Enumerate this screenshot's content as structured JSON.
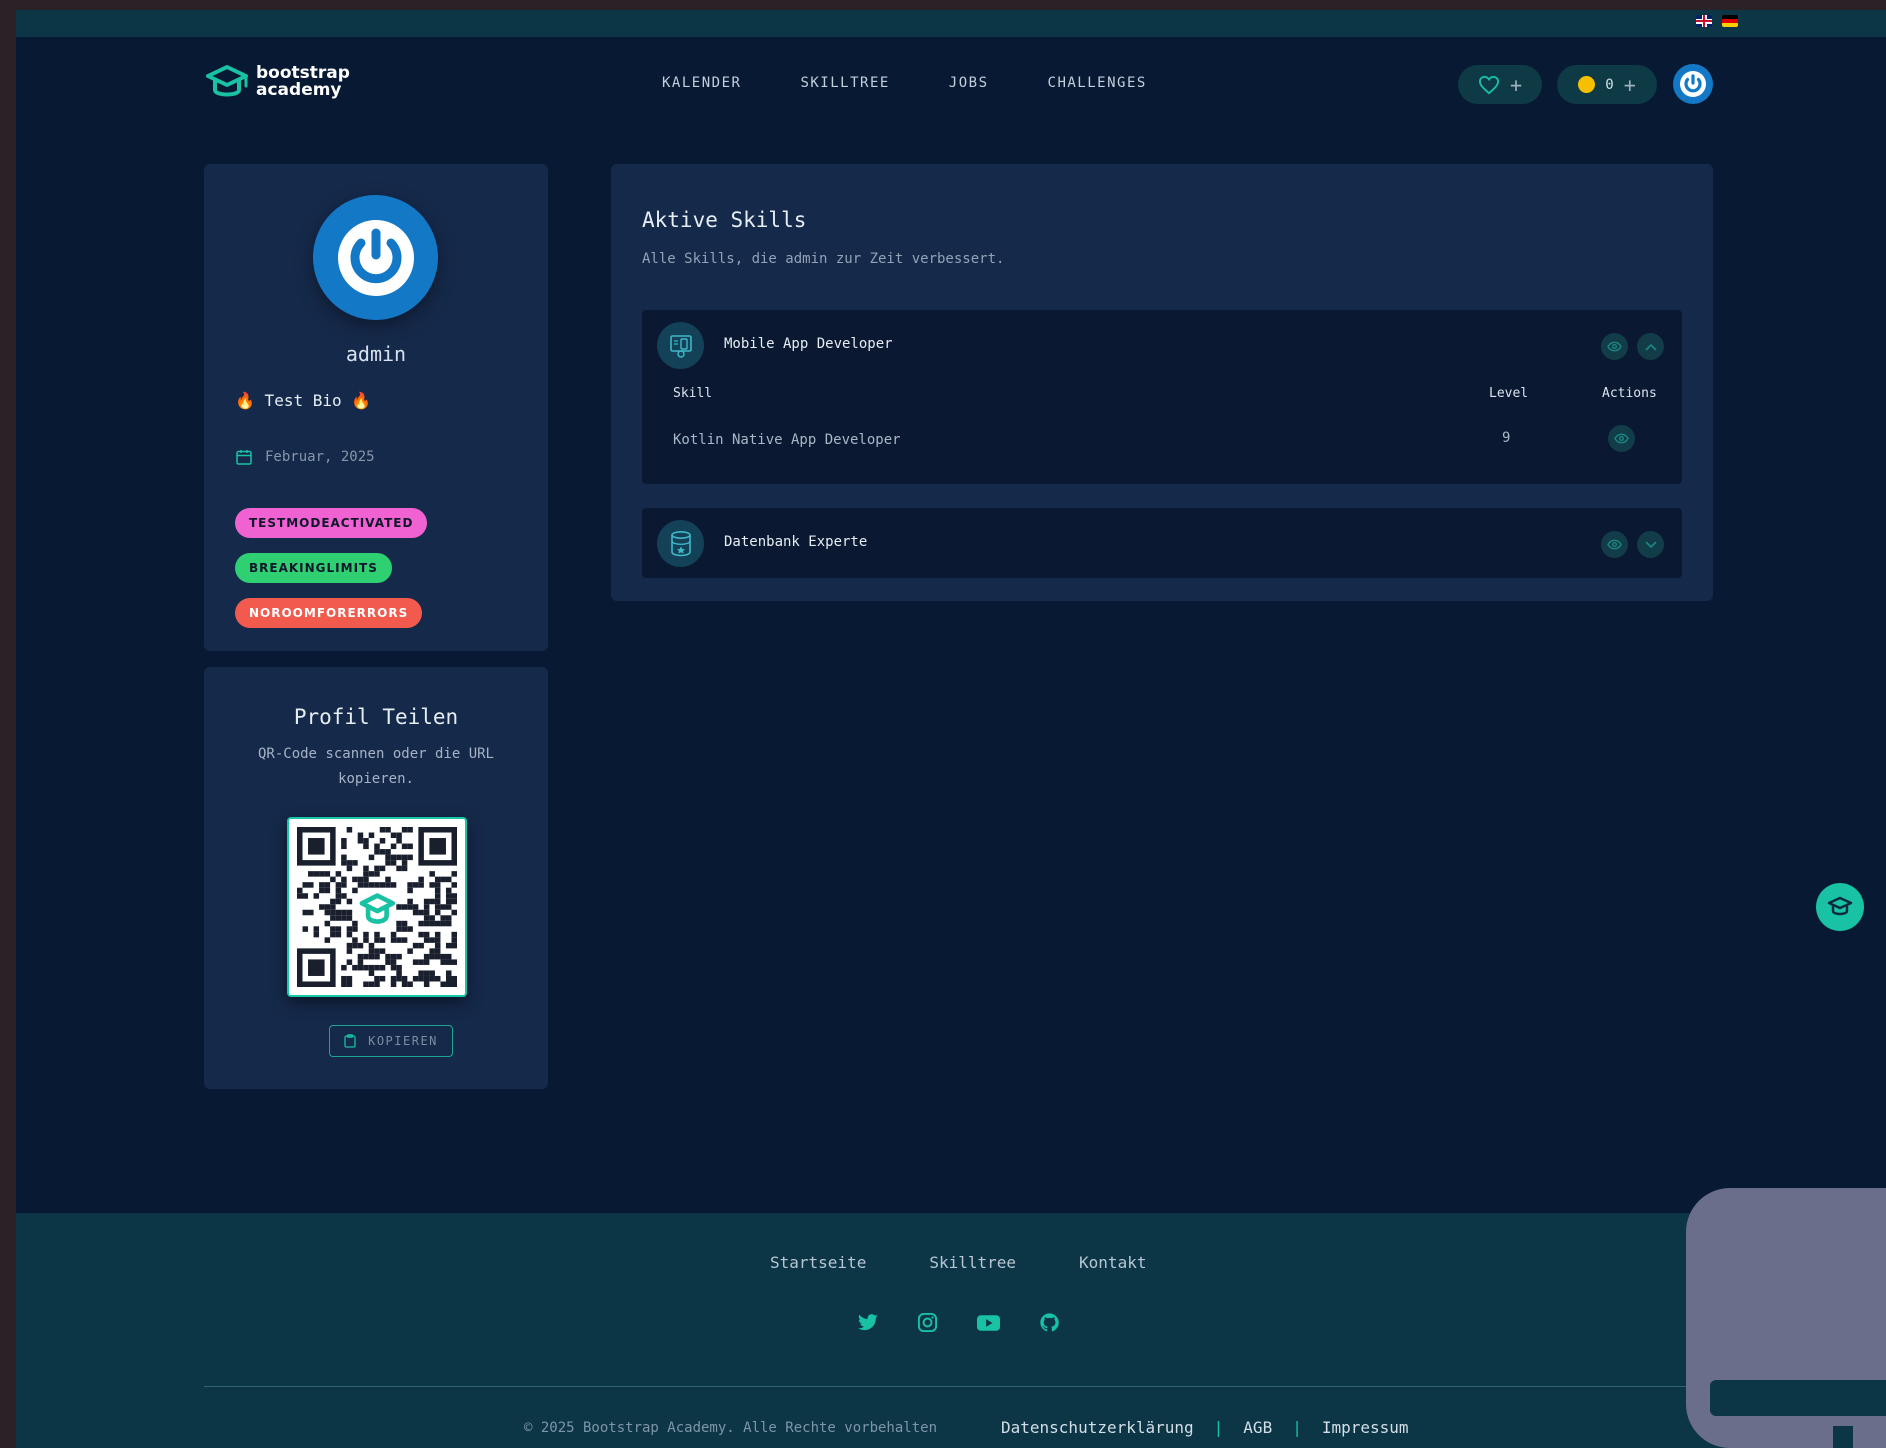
{
  "header": {
    "logo_line1": "bootstrap",
    "logo_line2": "academy",
    "nav": [
      "KALENDER",
      "SKILLTREE",
      "JOBS",
      "CHALLENGES"
    ],
    "hearts_add": "+",
    "coins_count": "0",
    "coins_add": "+"
  },
  "profile": {
    "username": "admin",
    "bio": "🔥 Test Bio 🔥",
    "joined": "Februar, 2025",
    "badges": [
      "TESTMODEACTIVATED",
      "BREAKINGLIMITS",
      "NOROOMFORERRORS"
    ]
  },
  "share": {
    "title": "Profil Teilen",
    "subtitle": "QR-Code scannen oder die URL kopieren.",
    "copy_label": "KOPIEREN"
  },
  "skills": {
    "title": "Aktive Skills",
    "subtitle": "Alle Skills, die admin zur Zeit verbessert.",
    "groups": [
      {
        "name": "Mobile App Developer",
        "expanded": true,
        "columns": [
          "Skill",
          "Level",
          "Actions"
        ],
        "rows": [
          {
            "skill": "Kotlin Native App Developer",
            "level": "9"
          }
        ]
      },
      {
        "name": "Datenbank Experte",
        "expanded": false
      }
    ]
  },
  "footer": {
    "nav": [
      "Startseite",
      "Skilltree",
      "Kontakt"
    ],
    "socials": [
      "twitter-icon",
      "instagram-icon",
      "youtube-icon",
      "github-icon"
    ],
    "copyright": "© 2025 Bootstrap Academy. Alle Rechte vorbehalten",
    "legal": [
      "Datenschutzerklärung",
      "AGB",
      "Impressum"
    ]
  },
  "colors": {
    "accent": "#18c2a3",
    "background": "#081a33",
    "card": "#15294a",
    "footer": "#0c3646"
  }
}
